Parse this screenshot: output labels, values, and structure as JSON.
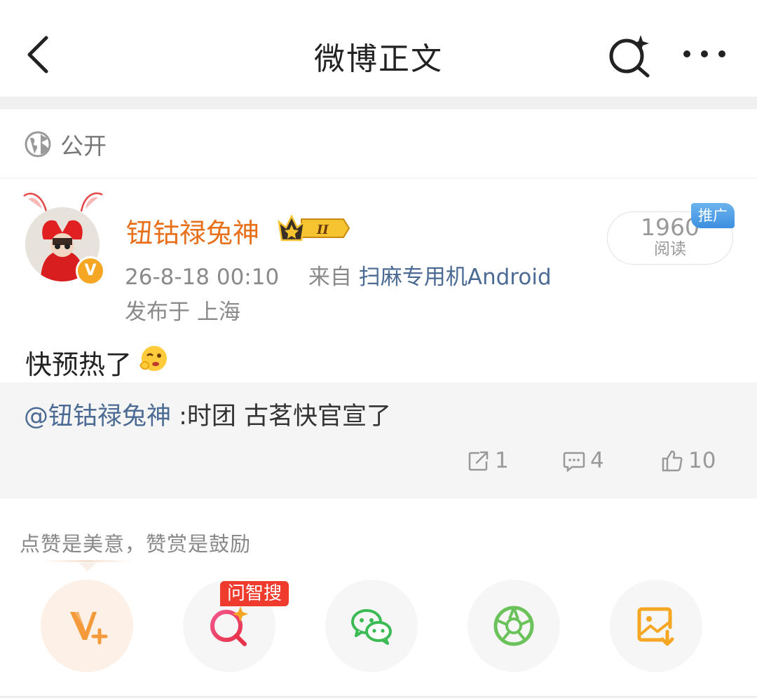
{
  "header": {
    "title": "微博正文"
  },
  "visibility": {
    "label": "公开"
  },
  "author": {
    "name": "钮钴禄兔神",
    "level_badge": "II",
    "verify_mark": "V",
    "time": "26-8-18 00:10",
    "source_prefix": "来自",
    "source": "扫麻专用机Android",
    "location": "发布于 上海"
  },
  "reads": {
    "count": "1960",
    "label": "阅读",
    "promo_tag": "推广"
  },
  "post": {
    "text": "快预热了"
  },
  "quoted": {
    "mention": "@钮钴禄兔神",
    "text": " :时团  古茗快官宣了",
    "reposts": "1",
    "comments": "4",
    "likes": "10"
  },
  "reward_hint": "点赞是美意，赞赏是鼓励",
  "share": {
    "items": [
      {
        "icon": "v-plus-icon",
        "color": "#f59a3a"
      },
      {
        "icon": "ai-search-icon",
        "color": "#e8334a",
        "badge": "问智搜"
      },
      {
        "icon": "wechat-icon",
        "color": "#3cba54"
      },
      {
        "icon": "moments-icon",
        "color": "#6bc25a"
      },
      {
        "icon": "save-image-icon",
        "color": "#f5a623"
      }
    ]
  }
}
